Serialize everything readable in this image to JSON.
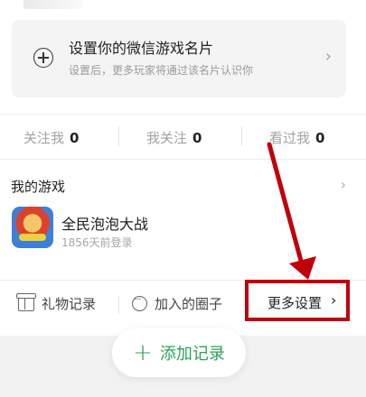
{
  "setup_card": {
    "title": "设置你的微信游戏名片",
    "subtitle": "设置后，更多玩家将通过该名片认识你",
    "chevron": "›"
  },
  "stats": [
    {
      "label": "关注我",
      "value": "0"
    },
    {
      "label": "我关注",
      "value": "0"
    },
    {
      "label": "看过我",
      "value": "0"
    }
  ],
  "my_games": {
    "header": "我的游戏",
    "chevron": "›",
    "items": [
      {
        "name": "全民泡泡大战",
        "sub": "1856天前登录",
        "icon": "game-app-icon"
      }
    ]
  },
  "actions": {
    "gift": {
      "label": "礼物记录",
      "icon": "gift-icon"
    },
    "circles": {
      "label": "加入的圈子",
      "icon": "chat-bubble-icon"
    },
    "more": {
      "label": "更多设置",
      "chevron": "›"
    }
  },
  "fab": {
    "plus": "+",
    "label": "添加记录"
  },
  "colors": {
    "accent_green": "#2aa35a",
    "annotation_red": "#c0000a",
    "card_bg": "#f4f4f4",
    "muted_text": "#a3a3a3"
  }
}
